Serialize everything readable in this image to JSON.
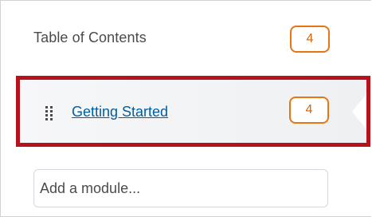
{
  "toc": {
    "label": "Table of Contents",
    "count": "4"
  },
  "modules": [
    {
      "title": "Getting Started",
      "count": "4",
      "selected": true
    }
  ],
  "add_module": {
    "placeholder": "Add a module..."
  },
  "colors": {
    "highlight_border": "#b5121b",
    "badge_border": "#e87511",
    "badge_text": "#d4660a",
    "link": "#005ea2",
    "text": "#494c4e"
  },
  "icons": {
    "drag_handle": "drag-handle-icon",
    "selection_pointer": "pointer-arrow-icon"
  }
}
